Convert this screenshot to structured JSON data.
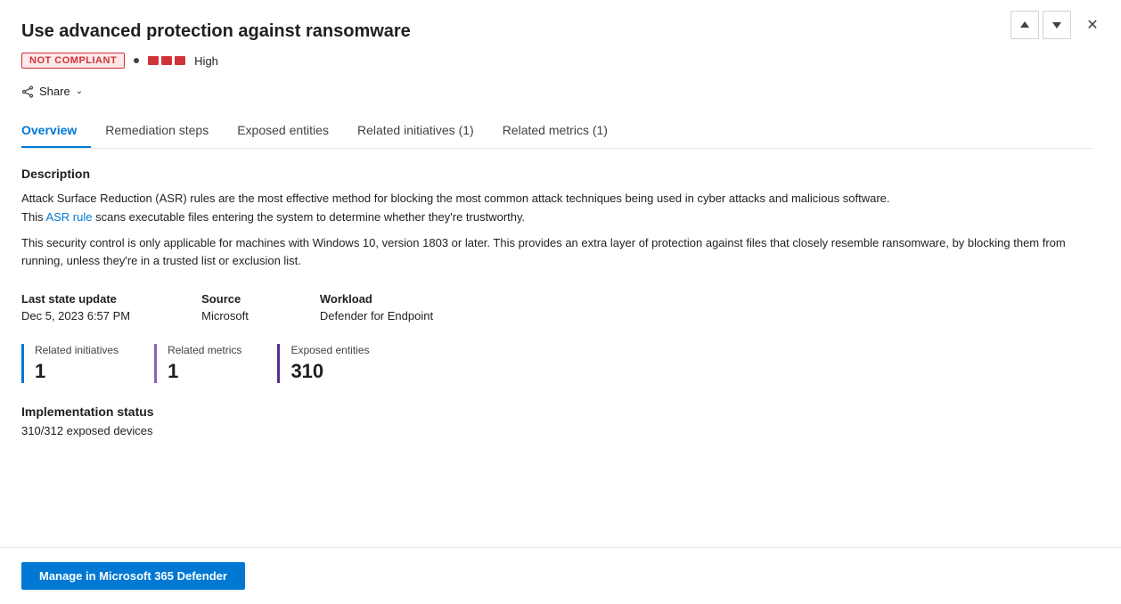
{
  "header": {
    "title": "Use advanced protection against ransomware",
    "nav_up_label": "↑",
    "nav_down_label": "↓",
    "close_label": "✕"
  },
  "badges": {
    "compliance": "NOT COMPLIANT",
    "severity_label": "High"
  },
  "share": {
    "label": "Share",
    "chevron": "∨"
  },
  "tabs": [
    {
      "id": "overview",
      "label": "Overview",
      "active": true
    },
    {
      "id": "remediation",
      "label": "Remediation steps",
      "active": false
    },
    {
      "id": "exposed",
      "label": "Exposed entities",
      "active": false
    },
    {
      "id": "initiatives",
      "label": "Related initiatives (1)",
      "active": false
    },
    {
      "id": "metrics",
      "label": "Related metrics (1)",
      "active": false
    }
  ],
  "description": {
    "title": "Description",
    "paragraph1_before_link": "Attack Surface Reduction (ASR) rules are the most effective method for blocking the most common attack techniques being used in cyber attacks and malicious software.\nThis ",
    "link_text": "ASR rule",
    "paragraph1_after_link": " scans executable files entering the system to determine whether they're trustworthy.",
    "paragraph2": "This security control is only applicable for machines with Windows 10, version 1803 or later.\nThis provides an extra layer of protection against files that closely resemble ransomware, by blocking them from running, unless they're in a trusted list or exclusion list."
  },
  "meta": {
    "last_state_label": "Last state update",
    "last_state_value": "Dec 5, 2023 6:57 PM",
    "source_label": "Source",
    "source_value": "Microsoft",
    "workload_label": "Workload",
    "workload_value": "Defender for Endpoint"
  },
  "stats": {
    "initiatives": {
      "label": "Related initiatives",
      "value": "1"
    },
    "metrics": {
      "label": "Related metrics",
      "value": "1"
    },
    "exposed": {
      "label": "Exposed entities",
      "value": "310"
    }
  },
  "implementation": {
    "title": "Implementation status",
    "value": "310/312 exposed devices"
  },
  "bottom_button": {
    "label": "Manage in Microsoft 365 Defender"
  }
}
